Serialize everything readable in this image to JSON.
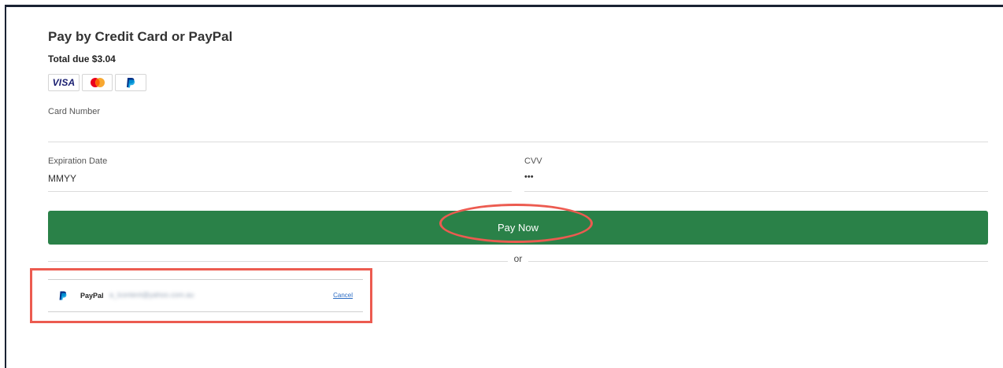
{
  "payment": {
    "title": "Pay by Credit Card or PayPal",
    "total_due": "Total due $3.04",
    "card_logos": {
      "visa": "VISA",
      "mastercard_icon": "mastercard-logo",
      "paypal_icon": "paypal-logo"
    },
    "card_number": {
      "label": "Card Number",
      "value": ""
    },
    "expiration": {
      "label": "Expiration Date",
      "placeholder": "MMYY"
    },
    "cvv": {
      "label": "CVV",
      "value": "•••"
    },
    "pay_button_label": "Pay Now",
    "separator": "or",
    "paypal_account": {
      "label": "PayPal",
      "email": "a_lcontent@yahoo.com.au",
      "cancel_label": "Cancel"
    }
  },
  "colors": {
    "pay_button": "#2a8148",
    "annotation": "#ec5b50",
    "link": "#2b6cc4"
  }
}
